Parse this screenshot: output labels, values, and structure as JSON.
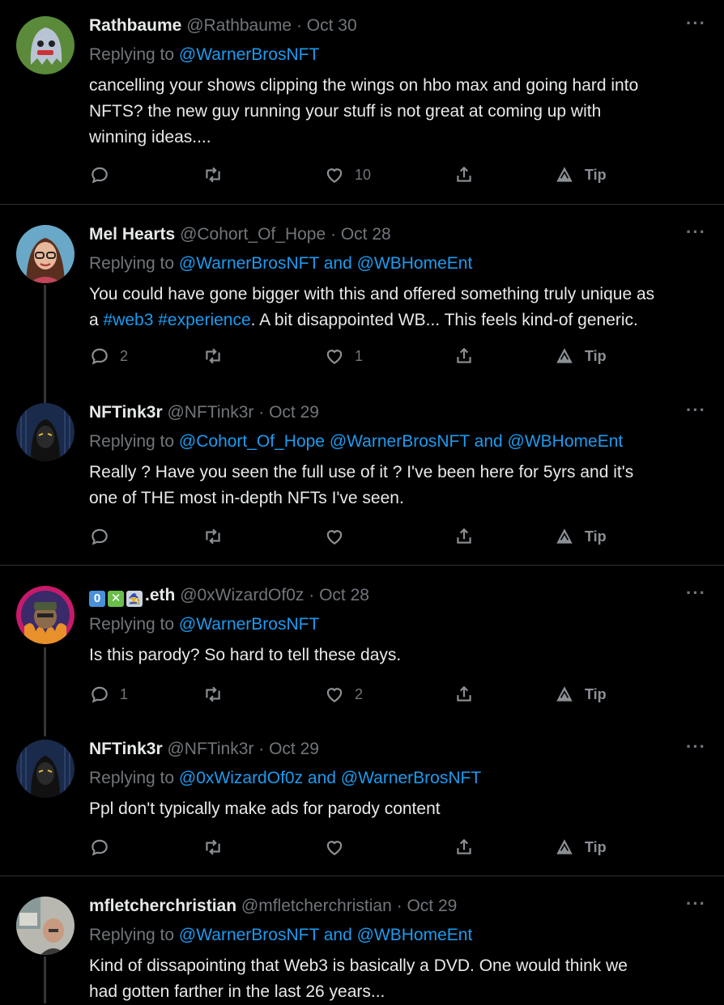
{
  "colors": {
    "background": "#000000",
    "link": "#1d9bf0",
    "muted": "#71767b",
    "text": "#e7e9ea"
  },
  "more_label": "···",
  "tweets": [
    {
      "name": "Rathbaume",
      "handle": "@Rathbaume",
      "sep": "·",
      "date": "Oct 30",
      "replying_prefix": "Replying to",
      "replying_targets": "@WarnerBrosNFT",
      "body_lines": [
        "cancelling your shows clipping the wings on hbo max and going hard into",
        "NFTS? the new guy running your stuff is not great at coming up with",
        "winning ideas...."
      ],
      "reply_count": "",
      "retweet_count": "",
      "like_count": "10",
      "tip_label": "Tip",
      "avatar_icon": "ghost-avatar"
    },
    {
      "name": "Mel Hearts",
      "handle": "@Cohort_Of_Hope",
      "sep": "·",
      "date": "Oct 28",
      "replying_prefix": "Replying to",
      "replying_targets": "@WarnerBrosNFT and @WBHomeEnt",
      "body_line1": "You could have gone bigger with this and offered something truly unique as",
      "body_line2_a": "a ",
      "body_line2_hash1": "#web3",
      "body_line2_space": " ",
      "body_line2_hash2": "#experience",
      "body_line2_b": ". A bit disappointed WB...  This feels kind-of generic.",
      "reply_count": "2",
      "retweet_count": "",
      "like_count": "1",
      "tip_label": "Tip",
      "avatar_icon": "woman-glasses-avatar"
    },
    {
      "name": "NFTink3r",
      "handle": "@NFTink3r",
      "sep": "·",
      "date": "Oct 29",
      "replying_prefix": "Replying to",
      "replying_targets": "@Cohort_Of_Hope @WarnerBrosNFT and @WBHomeEnt",
      "body_lines": [
        "Really ? Have you seen the full use of it ? I've been here for 5yrs and it's",
        "one of THE most in-depth NFTs I've seen."
      ],
      "reply_count": "",
      "retweet_count": "",
      "like_count": "",
      "tip_label": "Tip",
      "avatar_icon": "masked-figure-avatar"
    },
    {
      "name_badges": [
        "0",
        "✕",
        "🧙"
      ],
      "name": ".eth",
      "handle": "@0xWizardOf0z",
      "sep": "·",
      "date": "Oct 28",
      "replying_prefix": "Replying to",
      "replying_targets": "@WarnerBrosNFT",
      "body_lines": [
        "Is this parody? So hard to tell these days."
      ],
      "reply_count": "1",
      "retweet_count": "",
      "like_count": "2",
      "tip_label": "Tip",
      "avatar_icon": "wizard-avatar"
    },
    {
      "name": "NFTink3r",
      "handle": "@NFTink3r",
      "sep": "·",
      "date": "Oct 29",
      "replying_prefix": "Replying to",
      "replying_targets": "@0xWizardOf0z and @WarnerBrosNFT",
      "body_lines": [
        "Ppl don't typically make ads for parody content"
      ],
      "reply_count": "",
      "retweet_count": "",
      "like_count": "",
      "tip_label": "Tip",
      "avatar_icon": "masked-figure-avatar"
    },
    {
      "name": "mfletcherchristian",
      "handle": "@mfletcherchristian",
      "sep": "·",
      "date": "Oct 29",
      "replying_prefix": "Replying to",
      "replying_targets": "@WarnerBrosNFT and @WBHomeEnt",
      "body_lines": [
        "Kind of dissapointing that Web3 is basically a DVD.  One would think we",
        "had gotten farther in the last 26 years..."
      ],
      "avatar_icon": "man-photo-avatar"
    }
  ]
}
